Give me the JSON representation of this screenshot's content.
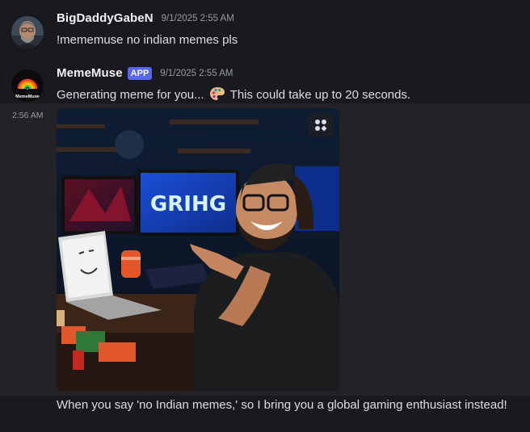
{
  "messages": [
    {
      "username": "BigDaddyGabeN",
      "timestamp": "9/1/2025 2:55 AM",
      "text": "!mememuse no indian memes pls"
    },
    {
      "username": "MemeMuse",
      "badge": "APP",
      "timestamp": "9/1/2025 2:55 AM",
      "text_before_emoji": "Generating meme for you...",
      "emoji": "palette-emoji",
      "text_after_emoji": "This could take up to 20 seconds.",
      "avatar_label": "MemeMuse"
    }
  ],
  "followup": {
    "side_time": "2:56 AM",
    "image_screen_text": "GRIHG",
    "caption": "When you say 'no Indian memes,' so I bring you a global gaming enthusiast instead!"
  },
  "colors": {
    "background": "#1a1a1e",
    "highlight_row": "#222227",
    "app_badge": "#5865f2",
    "username": "#f2f3f5",
    "timestamp": "#949ba4",
    "text": "#dbdee1"
  },
  "icons": [
    "palette-emoji",
    "apps-icon"
  ]
}
